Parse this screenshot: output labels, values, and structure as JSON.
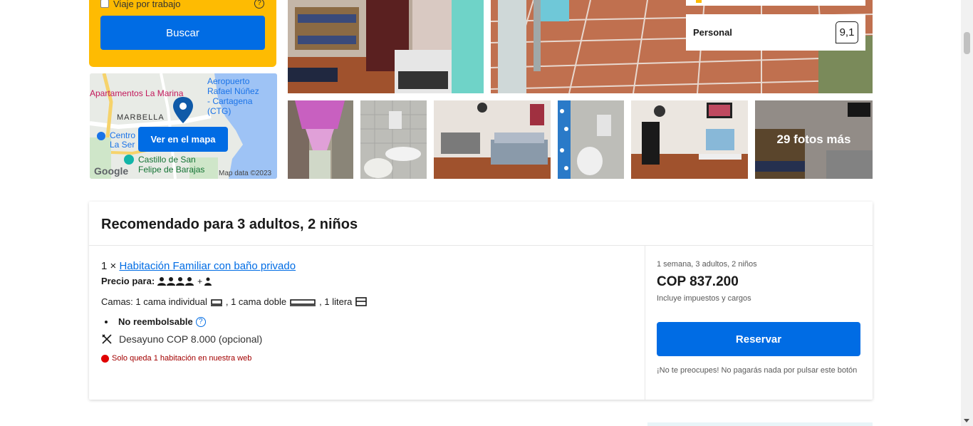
{
  "search_panel": {
    "trip_label": "Viaje por trabajo",
    "help_glyph": "?",
    "search_button": "Buscar"
  },
  "map": {
    "button_label": "Ver en el mapa",
    "labels": {
      "place": "Apartamentos La Marina",
      "airport": [
        "Aeropuerto",
        "Rafael Núñez",
        "- Cartagena",
        "(CTG)"
      ],
      "neighborhood": "MARBELLA",
      "centro": [
        "Centro",
        "La Ser"
      ],
      "castillo": [
        "Castillo de San",
        "Felipe de Barajas"
      ],
      "google": "Google",
      "map_data": "Map data ©2023"
    }
  },
  "gallery": {
    "more_photos": "29 fotos más"
  },
  "score": {
    "label": "Personal",
    "value": "9,1"
  },
  "recommendation": {
    "title": "Recomendado para 3 adultos, 2 niños",
    "quantity": "1 ×",
    "room_name": "Habitación Familiar con baño privado",
    "price_for_label": "Precio para:",
    "price_for_plus": "+",
    "beds_prefix": "Camas: 1 cama individual",
    "beds_mid1": ", 1 cama doble",
    "beds_mid2": ", 1 litera",
    "refund_label": "No reembolsable",
    "info_glyph": "?",
    "breakfast": "Desayuno COP 8.000 (opcional)",
    "scarcity": "Solo queda 1 habitación en nuestra web"
  },
  "pricing": {
    "stay_info": "1 semana, 3 adultos, 2 niños",
    "price": "COP 837.200",
    "taxes_note": "Incluye impuestos y cargos",
    "reserve_button": "Reservar",
    "reserve_note": "¡No te preocupes! No pagarás nada por pulsar este botón"
  },
  "colors": {
    "brand_blue": "#006ce4",
    "search_yellow": "#febb02",
    "alert_red": "#a30000"
  },
  "icons": [
    "question-icon",
    "map-pin-icon",
    "person-icon",
    "single-bed-icon",
    "double-bed-icon",
    "bunk-bed-icon",
    "info-icon",
    "cutlery-icon",
    "red-dot-icon"
  ]
}
